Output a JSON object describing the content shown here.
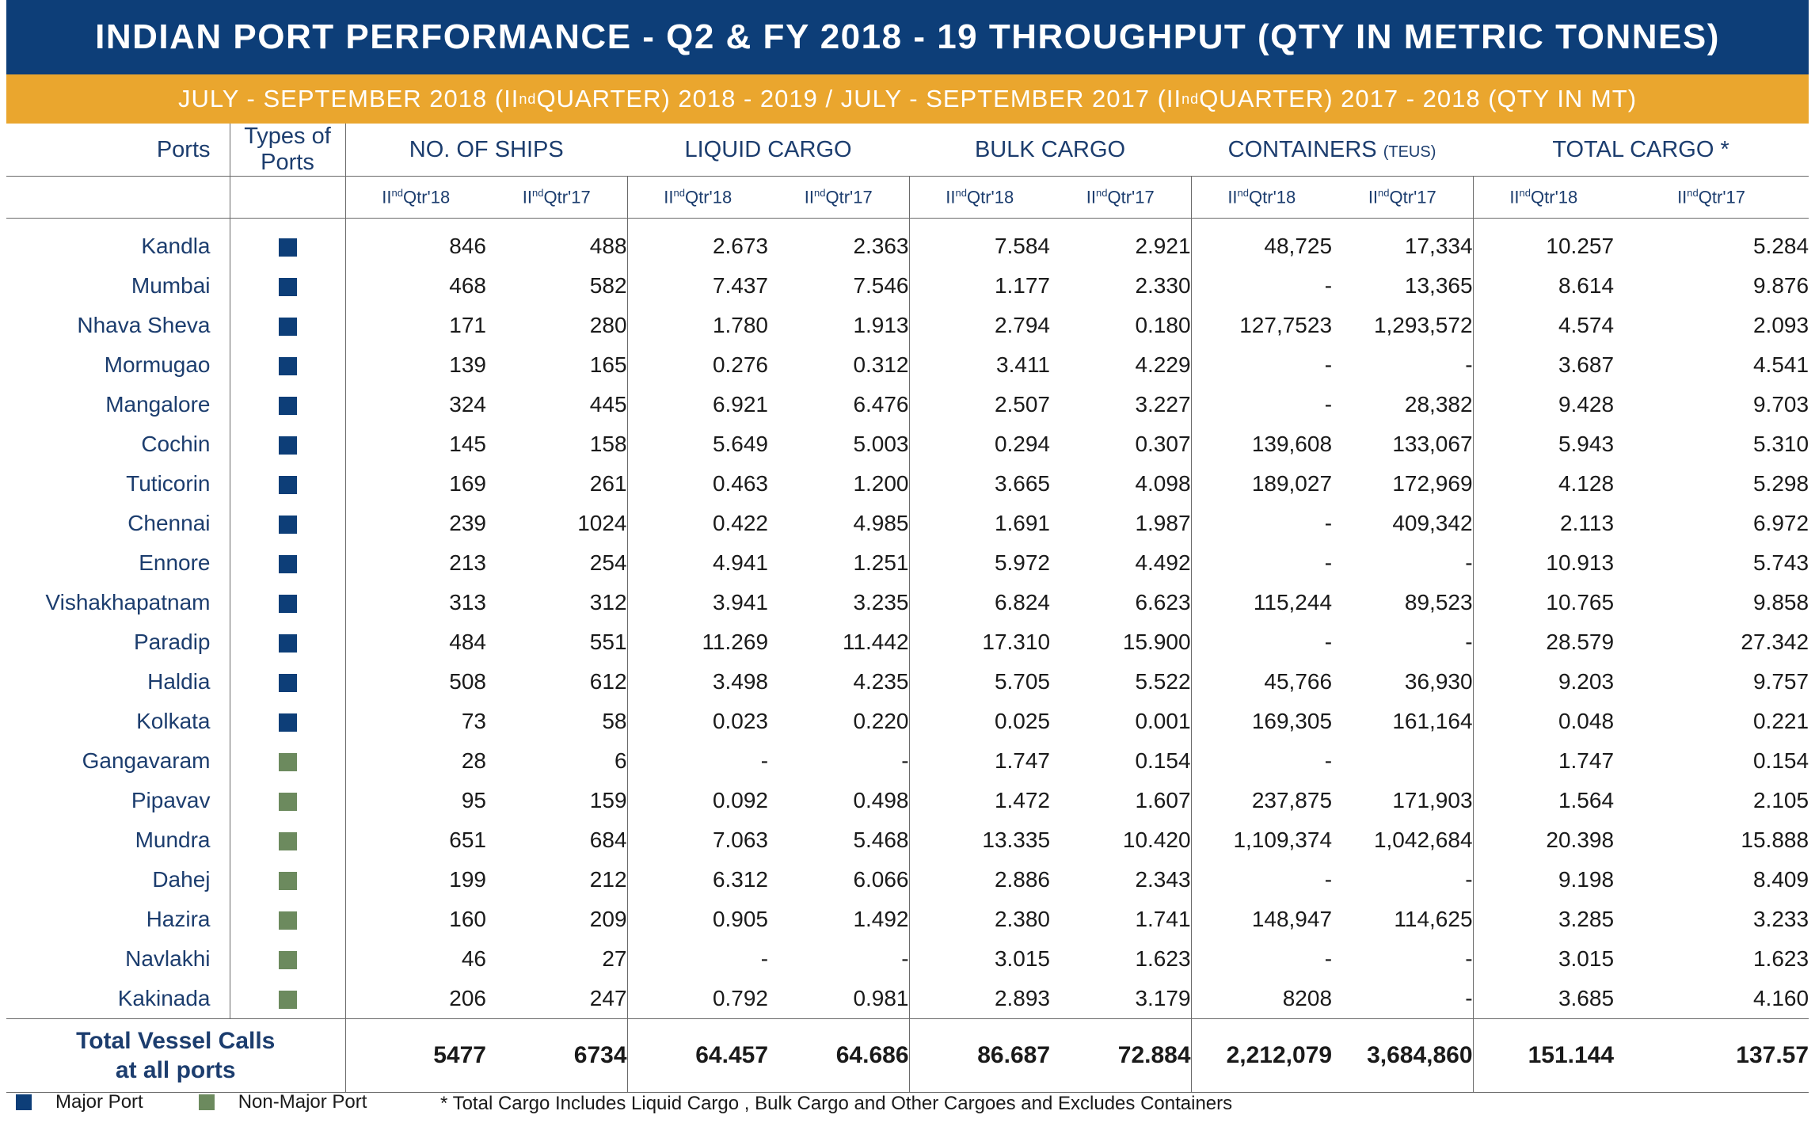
{
  "title": "INDIAN PORT PERFORMANCE - Q2 & FY 2018 - 19 THROUGHPUT (QTY IN METRIC TONNES)",
  "subtitle": {
    "part1": "JULY - SEPTEMBER 2018 (II",
    "sup": "nd",
    "part2": " QUARTER) 2018 - 2019 / JULY - SEPTEMBER  2017 (II",
    "part3": " QUARTER)  2017 - 2018 (QTY IN MT)"
  },
  "headers": {
    "ports": "Ports",
    "types": "Types of Ports",
    "ships": "NO. OF SHIPS",
    "liquid": "LIQUID CARGO",
    "bulk": "BULK CARGO",
    "containers": "CONTAINERS",
    "containers_unit": "(TEUS)",
    "total": "TOTAL CARGO *"
  },
  "subheaders": {
    "roman": "II",
    "sup": "nd",
    "q18": "Qtr'18",
    "q17": "Qtr'17"
  },
  "type_colors": {
    "major": "#0d3e78",
    "nonmajor": "#6c8a5e"
  },
  "rows": [
    {
      "port": "Kandla",
      "type": "major",
      "values": [
        "846",
        "488",
        "2.673",
        "2.363",
        "7.584",
        "2.921",
        "48,725",
        "17,334",
        "10.257",
        "5.284"
      ]
    },
    {
      "port": "Mumbai",
      "type": "major",
      "values": [
        "468",
        "582",
        "7.437",
        "7.546",
        "1.177",
        "2.330",
        "-",
        "13,365",
        "8.614",
        "9.876"
      ]
    },
    {
      "port": "Nhava Sheva",
      "type": "major",
      "values": [
        "171",
        "280",
        "1.780",
        "1.913",
        "2.794",
        "0.180",
        "127,7523",
        "1,293,572",
        "4.574",
        "2.093"
      ]
    },
    {
      "port": "Mormugao",
      "type": "major",
      "values": [
        "139",
        "165",
        "0.276",
        "0.312",
        "3.411",
        "4.229",
        "-",
        "-",
        "3.687",
        "4.541"
      ]
    },
    {
      "port": "Mangalore",
      "type": "major",
      "values": [
        "324",
        "445",
        "6.921",
        "6.476",
        "2.507",
        "3.227",
        "-",
        "28,382",
        "9.428",
        "9.703"
      ]
    },
    {
      "port": "Cochin",
      "type": "major",
      "values": [
        "145",
        "158",
        "5.649",
        "5.003",
        "0.294",
        "0.307",
        "139,608",
        "133,067",
        "5.943",
        "5.310"
      ]
    },
    {
      "port": "Tuticorin",
      "type": "major",
      "values": [
        "169",
        "261",
        "0.463",
        "1.200",
        "3.665",
        "4.098",
        "189,027",
        "172,969",
        "4.128",
        "5.298"
      ]
    },
    {
      "port": "Chennai",
      "type": "major",
      "values": [
        "239",
        "1024",
        "0.422",
        "4.985",
        "1.691",
        "1.987",
        "-",
        "409,342",
        "2.113",
        "6.972"
      ]
    },
    {
      "port": "Ennore",
      "type": "major",
      "values": [
        "213",
        "254",
        "4.941",
        "1.251",
        "5.972",
        "4.492",
        "-",
        "-",
        "10.913",
        "5.743"
      ]
    },
    {
      "port": "Vishakhapatnam",
      "type": "major",
      "values": [
        "313",
        "312",
        "3.941",
        "3.235",
        "6.824",
        "6.623",
        "115,244",
        "89,523",
        "10.765",
        "9.858"
      ]
    },
    {
      "port": "Paradip",
      "type": "major",
      "values": [
        "484",
        "551",
        "11.269",
        "11.442",
        "17.310",
        "15.900",
        "-",
        "-",
        "28.579",
        "27.342"
      ]
    },
    {
      "port": "Haldia",
      "type": "major",
      "values": [
        "508",
        "612",
        "3.498",
        "4.235",
        "5.705",
        "5.522",
        "45,766",
        "36,930",
        "9.203",
        "9.757"
      ]
    },
    {
      "port": "Kolkata",
      "type": "major",
      "values": [
        "73",
        "58",
        "0.023",
        "0.220",
        "0.025",
        "0.001",
        "169,305",
        "161,164",
        "0.048",
        "0.221"
      ]
    },
    {
      "port": "Gangavaram",
      "type": "nonmajor",
      "values": [
        "28",
        "6",
        "-",
        "-",
        "1.747",
        "0.154",
        "-",
        "",
        "1.747",
        "0.154"
      ]
    },
    {
      "port": "Pipavav",
      "type": "nonmajor",
      "values": [
        "95",
        "159",
        "0.092",
        "0.498",
        "1.472",
        "1.607",
        "237,875",
        "171,903",
        "1.564",
        "2.105"
      ]
    },
    {
      "port": "Mundra",
      "type": "nonmajor",
      "values": [
        "651",
        "684",
        "7.063",
        "5.468",
        "13.335",
        "10.420",
        "1,109,374",
        "1,042,684",
        "20.398",
        "15.888"
      ]
    },
    {
      "port": "Dahej",
      "type": "nonmajor",
      "values": [
        "199",
        "212",
        "6.312",
        "6.066",
        "2.886",
        "2.343",
        "-",
        "-",
        "9.198",
        "8.409"
      ]
    },
    {
      "port": "Hazira",
      "type": "nonmajor",
      "values": [
        "160",
        "209",
        "0.905",
        "1.492",
        "2.380",
        "1.741",
        "148,947",
        "114,625",
        "3.285",
        "3.233"
      ]
    },
    {
      "port": "Navlakhi",
      "type": "nonmajor",
      "values": [
        "46",
        "27",
        "-",
        "-",
        "3.015",
        "1.623",
        "-",
        "-",
        "3.015",
        "1.623"
      ]
    },
    {
      "port": "Kakinada",
      "type": "nonmajor",
      "values": [
        "206",
        "247",
        "0.792",
        "0.981",
        "2.893",
        "3.179",
        "8208",
        "-",
        "3.685",
        "4.160"
      ]
    }
  ],
  "total": {
    "label_line1": "Total Vessel Calls",
    "label_line2": "at all ports",
    "values": [
      "5477",
      "6734",
      "64.457",
      "64.686",
      "86.687",
      "72.884",
      "2,212,079",
      "3,684,860",
      "151.144",
      "137.57"
    ]
  },
  "legend": {
    "major": "Major Port",
    "nonmajor": "Non-Major Port"
  },
  "footnote": "* Total Cargo Includes Liquid Cargo , Bulk Cargo and Other Cargoes and Excludes Containers"
}
